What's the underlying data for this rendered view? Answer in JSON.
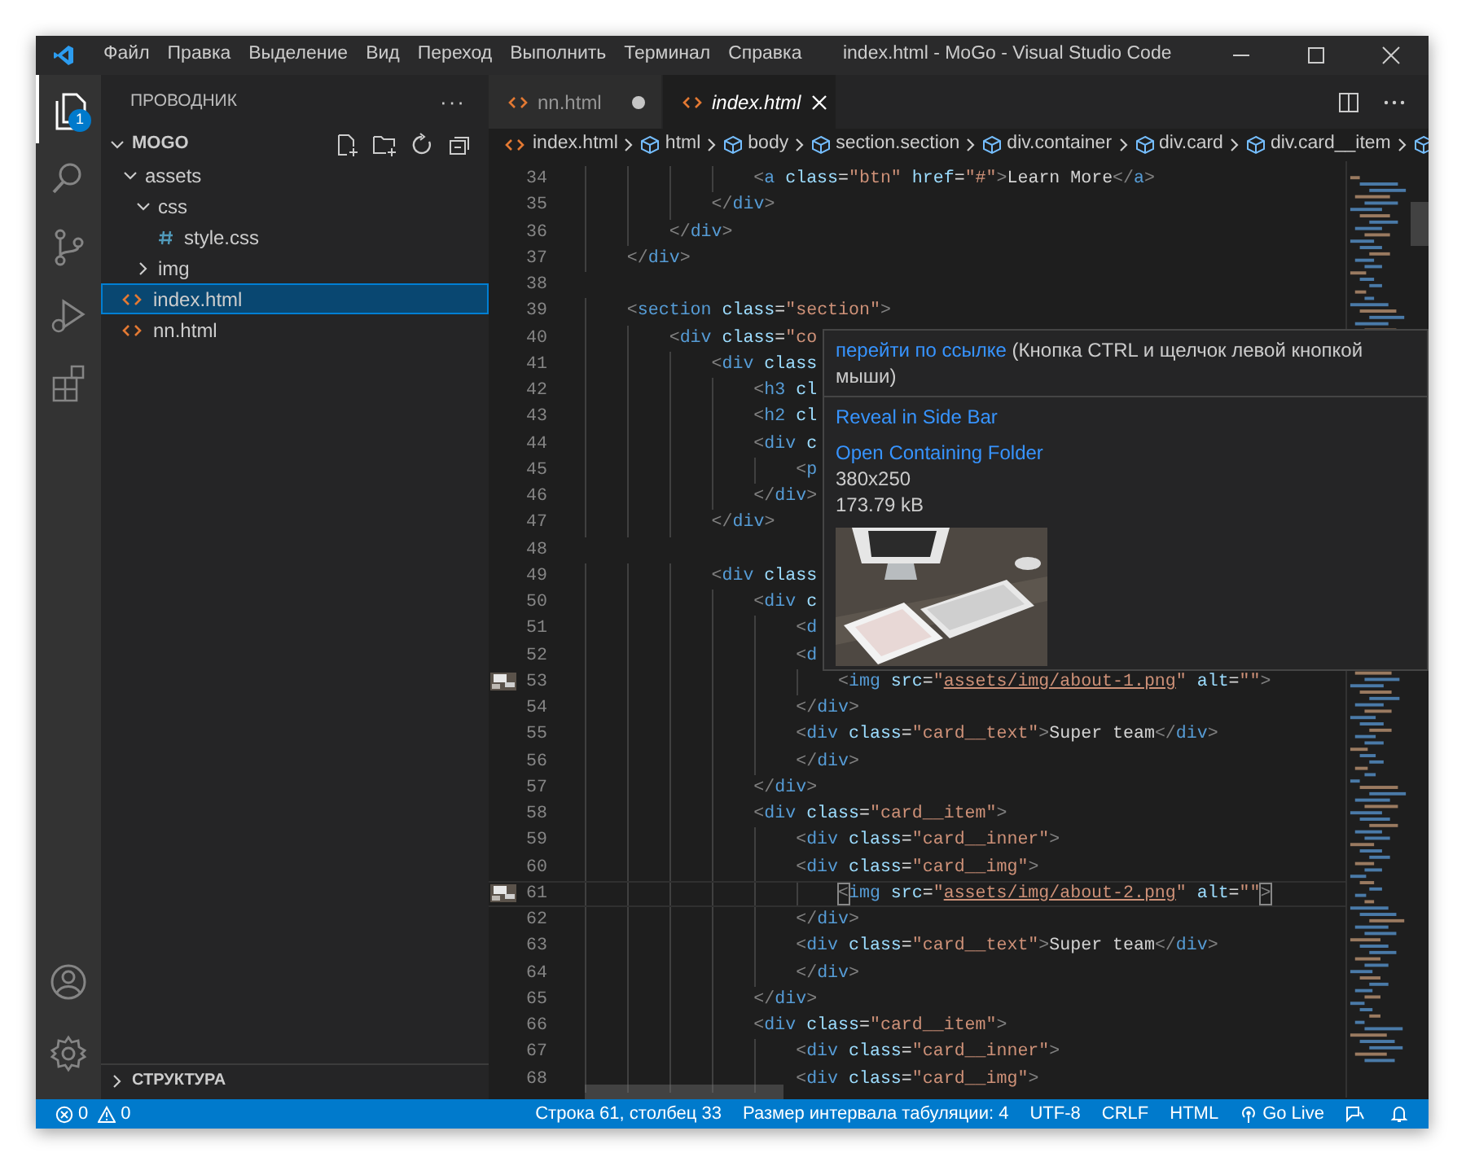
{
  "title_bar": {
    "menu": [
      "Файл",
      "Правка",
      "Выделение",
      "Вид",
      "Переход",
      "Выполнить",
      "Терминал",
      "Справка"
    ],
    "title": "index.html - MoGo - Visual Studio Code"
  },
  "activity_bar": {
    "items": [
      {
        "kind": "files",
        "selected": true,
        "badge": "1"
      },
      {
        "kind": "search",
        "selected": false
      },
      {
        "kind": "source-control",
        "selected": false
      },
      {
        "kind": "run",
        "selected": false
      },
      {
        "kind": "extensions",
        "selected": false
      }
    ],
    "bottom": [
      {
        "kind": "account"
      },
      {
        "kind": "settings"
      }
    ]
  },
  "sidebar": {
    "title": "ПРОВОДНИК",
    "more": "···",
    "folder": {
      "name": "MOGO",
      "expanded": true
    },
    "tree": [
      {
        "name": "assets",
        "kind": "folder",
        "expanded": true,
        "selected": false,
        "children": [
          {
            "name": "css",
            "kind": "folder",
            "expanded": true,
            "selected": false,
            "children": [
              {
                "name": "style.css",
                "kind": "css",
                "selected": false
              }
            ]
          },
          {
            "name": "img",
            "kind": "folder",
            "expanded": false,
            "selected": false
          }
        ]
      },
      {
        "name": "index.html",
        "kind": "html",
        "selected": true
      },
      {
        "name": "nn.html",
        "kind": "html",
        "selected": false
      }
    ],
    "outline": {
      "title": "СТРУКТУРА",
      "expanded": false
    }
  },
  "tabs": [
    {
      "label": "nn.html",
      "selected": false,
      "dirty": true
    },
    {
      "label": "index.html",
      "selected": true,
      "dirty": false
    }
  ],
  "breadcrumbs": [
    {
      "label": "index.html",
      "kind": "file"
    },
    {
      "label": "html",
      "kind": "element"
    },
    {
      "label": "body",
      "kind": "element"
    },
    {
      "label": "section.section",
      "kind": "element"
    },
    {
      "label": "div.container",
      "kind": "element"
    },
    {
      "label": "div.card",
      "kind": "element"
    },
    {
      "label": "div.card__item",
      "kind": "element"
    }
  ],
  "editor": {
    "lines": [
      {
        "n": "34",
        "code": [
          {
            "kind": "punct",
            "text": "                <"
          },
          {
            "kind": "tag",
            "text": "a"
          },
          {
            "kind": "attr",
            "text": " class"
          },
          {
            "kind": "eq",
            "text": "="
          },
          {
            "kind": "string",
            "text": "\"btn\""
          },
          {
            "kind": "attr",
            "text": " href"
          },
          {
            "kind": "eq",
            "text": "="
          },
          {
            "kind": "string",
            "text": "\"#\""
          },
          {
            "kind": "punct",
            "text": ">"
          },
          {
            "kind": "text",
            "text": "Learn More"
          },
          {
            "kind": "punct",
            "text": "</"
          },
          {
            "kind": "tag",
            "text": "a"
          },
          {
            "kind": "punct",
            "text": ">"
          }
        ]
      },
      {
        "n": "35",
        "code": [
          {
            "kind": "punct",
            "text": "            </"
          },
          {
            "kind": "tag",
            "text": "div"
          },
          {
            "kind": "punct",
            "text": ">"
          }
        ]
      },
      {
        "n": "36",
        "code": [
          {
            "kind": "punct",
            "text": "        </"
          },
          {
            "kind": "tag",
            "text": "div"
          },
          {
            "kind": "punct",
            "text": ">"
          }
        ]
      },
      {
        "n": "37",
        "code": [
          {
            "kind": "punct",
            "text": "    </"
          },
          {
            "kind": "tag",
            "text": "div"
          },
          {
            "kind": "punct",
            "text": ">"
          }
        ]
      },
      {
        "n": "38"
      },
      {
        "n": "39",
        "code": [
          {
            "kind": "punct",
            "text": "    <"
          },
          {
            "kind": "tag",
            "text": "section"
          },
          {
            "kind": "attr",
            "text": " class"
          },
          {
            "kind": "eq",
            "text": "="
          },
          {
            "kind": "string",
            "text": "\"section\""
          },
          {
            "kind": "punct",
            "text": ">"
          }
        ]
      },
      {
        "n": "40",
        "code": [
          {
            "kind": "punct",
            "text": "        <"
          },
          {
            "kind": "tag",
            "text": "div"
          },
          {
            "kind": "attr",
            "text": " class"
          },
          {
            "kind": "eq",
            "text": "="
          },
          {
            "kind": "string",
            "text": "\"co"
          }
        ]
      },
      {
        "n": "41",
        "code": [
          {
            "kind": "punct",
            "text": "            <"
          },
          {
            "kind": "tag",
            "text": "div"
          },
          {
            "kind": "attr",
            "text": " class"
          }
        ]
      },
      {
        "n": "42",
        "code": [
          {
            "kind": "punct",
            "text": "                <"
          },
          {
            "kind": "tag",
            "text": "h3"
          },
          {
            "kind": "attr",
            "text": " cl"
          }
        ]
      },
      {
        "n": "43",
        "code": [
          {
            "kind": "punct",
            "text": "                <"
          },
          {
            "kind": "tag",
            "text": "h2"
          },
          {
            "kind": "attr",
            "text": " cl"
          }
        ]
      },
      {
        "n": "44",
        "code": [
          {
            "kind": "punct",
            "text": "                <"
          },
          {
            "kind": "tag",
            "text": "div"
          },
          {
            "kind": "attr",
            "text": " c"
          }
        ]
      },
      {
        "n": "45",
        "code": [
          {
            "kind": "punct",
            "text": "                    <"
          },
          {
            "kind": "tag",
            "text": "p"
          }
        ]
      },
      {
        "n": "46",
        "code": [
          {
            "kind": "punct",
            "text": "                </"
          },
          {
            "kind": "tag",
            "text": "div"
          },
          {
            "kind": "punct",
            "text": ">"
          }
        ]
      },
      {
        "n": "47",
        "code": [
          {
            "kind": "punct",
            "text": "            </"
          },
          {
            "kind": "tag",
            "text": "div"
          },
          {
            "kind": "punct",
            "text": ">"
          }
        ]
      },
      {
        "n": "48"
      },
      {
        "n": "49",
        "code": [
          {
            "kind": "punct",
            "text": "            <"
          },
          {
            "kind": "tag",
            "text": "div"
          },
          {
            "kind": "attr",
            "text": " class"
          }
        ]
      },
      {
        "n": "50",
        "code": [
          {
            "kind": "punct",
            "text": "                <"
          },
          {
            "kind": "tag",
            "text": "div"
          },
          {
            "kind": "attr",
            "text": " c"
          }
        ]
      },
      {
        "n": "51",
        "code": [
          {
            "kind": "punct",
            "text": "                    <"
          },
          {
            "kind": "tag",
            "text": "d"
          }
        ]
      },
      {
        "n": "52",
        "code": [
          {
            "kind": "punct",
            "text": "                    <"
          },
          {
            "kind": "tag",
            "text": "d"
          }
        ]
      },
      {
        "n": "53",
        "thumbnail": true,
        "code": [
          {
            "kind": "punct",
            "text": "                        <"
          },
          {
            "kind": "tag",
            "text": "img"
          },
          {
            "kind": "attr",
            "text": " src"
          },
          {
            "kind": "eq",
            "text": "="
          },
          {
            "kind": "string",
            "text": "\""
          },
          {
            "kind": "link",
            "text": "assets/img/about-1.png"
          },
          {
            "kind": "string",
            "text": "\""
          },
          {
            "kind": "attr",
            "text": " alt"
          },
          {
            "kind": "eq",
            "text": "="
          },
          {
            "kind": "string",
            "text": "\"\""
          },
          {
            "kind": "punct",
            "text": ">"
          }
        ]
      },
      {
        "n": "54",
        "code": [
          {
            "kind": "punct",
            "text": "                    </"
          },
          {
            "kind": "tag",
            "text": "div"
          },
          {
            "kind": "punct",
            "text": ">"
          }
        ]
      },
      {
        "n": "55",
        "code": [
          {
            "kind": "punct",
            "text": "                    <"
          },
          {
            "kind": "tag",
            "text": "div"
          },
          {
            "kind": "attr",
            "text": " class"
          },
          {
            "kind": "eq",
            "text": "="
          },
          {
            "kind": "string",
            "text": "\"card__text\""
          },
          {
            "kind": "punct",
            "text": ">"
          },
          {
            "kind": "text",
            "text": "Super team"
          },
          {
            "kind": "punct",
            "text": "</"
          },
          {
            "kind": "tag",
            "text": "div"
          },
          {
            "kind": "punct",
            "text": ">"
          }
        ]
      },
      {
        "n": "56",
        "code": [
          {
            "kind": "punct",
            "text": "                    </"
          },
          {
            "kind": "tag",
            "text": "div"
          },
          {
            "kind": "punct",
            "text": ">"
          }
        ]
      },
      {
        "n": "57",
        "code": [
          {
            "kind": "punct",
            "text": "                </"
          },
          {
            "kind": "tag",
            "text": "div"
          },
          {
            "kind": "punct",
            "text": ">"
          }
        ]
      },
      {
        "n": "58",
        "code": [
          {
            "kind": "punct",
            "text": "                <"
          },
          {
            "kind": "tag",
            "text": "div"
          },
          {
            "kind": "attr",
            "text": " class"
          },
          {
            "kind": "eq",
            "text": "="
          },
          {
            "kind": "string",
            "text": "\"card__item\""
          },
          {
            "kind": "punct",
            "text": ">"
          }
        ]
      },
      {
        "n": "59",
        "code": [
          {
            "kind": "punct",
            "text": "                    <"
          },
          {
            "kind": "tag",
            "text": "div"
          },
          {
            "kind": "attr",
            "text": " class"
          },
          {
            "kind": "eq",
            "text": "="
          },
          {
            "kind": "string",
            "text": "\"card__inner\""
          },
          {
            "kind": "punct",
            "text": ">"
          }
        ]
      },
      {
        "n": "60",
        "code": [
          {
            "kind": "punct",
            "text": "                    <"
          },
          {
            "kind": "tag",
            "text": "div"
          },
          {
            "kind": "attr",
            "text": " class"
          },
          {
            "kind": "eq",
            "text": "="
          },
          {
            "kind": "string",
            "text": "\"card__img\""
          },
          {
            "kind": "punct",
            "text": ">"
          }
        ]
      },
      {
        "n": "61",
        "thumbnail": true,
        "current": true,
        "code": [
          {
            "kind": "bracket",
            "text": "                        <"
          },
          {
            "kind": "tag",
            "text": "img"
          },
          {
            "kind": "attr",
            "text": " src"
          },
          {
            "kind": "eq",
            "text": "="
          },
          {
            "kind": "string",
            "text": "\""
          },
          {
            "kind": "link",
            "text": "assets/img/about-2.png"
          },
          {
            "kind": "string",
            "text": "\""
          },
          {
            "kind": "attr",
            "text": " alt"
          },
          {
            "kind": "eq",
            "text": "="
          },
          {
            "kind": "string",
            "text": "\"\""
          },
          {
            "kind": "bracket",
            "text": ">"
          }
        ]
      },
      {
        "n": "62",
        "code": [
          {
            "kind": "punct",
            "text": "                    </"
          },
          {
            "kind": "tag",
            "text": "div"
          },
          {
            "kind": "punct",
            "text": ">"
          }
        ]
      },
      {
        "n": "63",
        "code": [
          {
            "kind": "punct",
            "text": "                    <"
          },
          {
            "kind": "tag",
            "text": "div"
          },
          {
            "kind": "attr",
            "text": " class"
          },
          {
            "kind": "eq",
            "text": "="
          },
          {
            "kind": "string",
            "text": "\"card__text\""
          },
          {
            "kind": "punct",
            "text": ">"
          },
          {
            "kind": "text",
            "text": "Super team"
          },
          {
            "kind": "punct",
            "text": "</"
          },
          {
            "kind": "tag",
            "text": "div"
          },
          {
            "kind": "punct",
            "text": ">"
          }
        ]
      },
      {
        "n": "64",
        "code": [
          {
            "kind": "punct",
            "text": "                    </"
          },
          {
            "kind": "tag",
            "text": "div"
          },
          {
            "kind": "punct",
            "text": ">"
          }
        ]
      },
      {
        "n": "65",
        "code": [
          {
            "kind": "punct",
            "text": "                </"
          },
          {
            "kind": "tag",
            "text": "div"
          },
          {
            "kind": "punct",
            "text": ">"
          }
        ]
      },
      {
        "n": "66",
        "code": [
          {
            "kind": "punct",
            "text": "                <"
          },
          {
            "kind": "tag",
            "text": "div"
          },
          {
            "kind": "attr",
            "text": " class"
          },
          {
            "kind": "eq",
            "text": "="
          },
          {
            "kind": "string",
            "text": "\"card__item\""
          },
          {
            "kind": "punct",
            "text": ">"
          }
        ]
      },
      {
        "n": "67",
        "code": [
          {
            "kind": "punct",
            "text": "                    <"
          },
          {
            "kind": "tag",
            "text": "div"
          },
          {
            "kind": "attr",
            "text": " class"
          },
          {
            "kind": "eq",
            "text": "="
          },
          {
            "kind": "string",
            "text": "\"card__inner\""
          },
          {
            "kind": "punct",
            "text": ">"
          }
        ]
      },
      {
        "n": "68",
        "code": [
          {
            "kind": "punct",
            "text": "                    <"
          },
          {
            "kind": "tag",
            "text": "div"
          },
          {
            "kind": "attr",
            "text": " class"
          },
          {
            "kind": "eq",
            "text": "="
          },
          {
            "kind": "string",
            "text": "\"card__img\""
          },
          {
            "kind": "punct",
            "text": ">"
          }
        ]
      }
    ],
    "hover": {
      "link": "перейти по ссылке",
      "hint": "(Кнопка CTRL и щелчок левой кнопкой мыши)",
      "actions": [
        "Reveal in Side Bar",
        "Open Containing Folder"
      ],
      "dimensions": "380x250",
      "size": "173.79 kB",
      "preview": {
        "kind": "picture"
      }
    }
  },
  "status_bar": {
    "errors": "0",
    "warnings": "0",
    "items": [
      "Строка 61, столбец 33",
      "Размер интервала табуляции: 4",
      "UTF-8",
      "CRLF",
      "HTML"
    ],
    "go_live": "Go Live"
  }
}
